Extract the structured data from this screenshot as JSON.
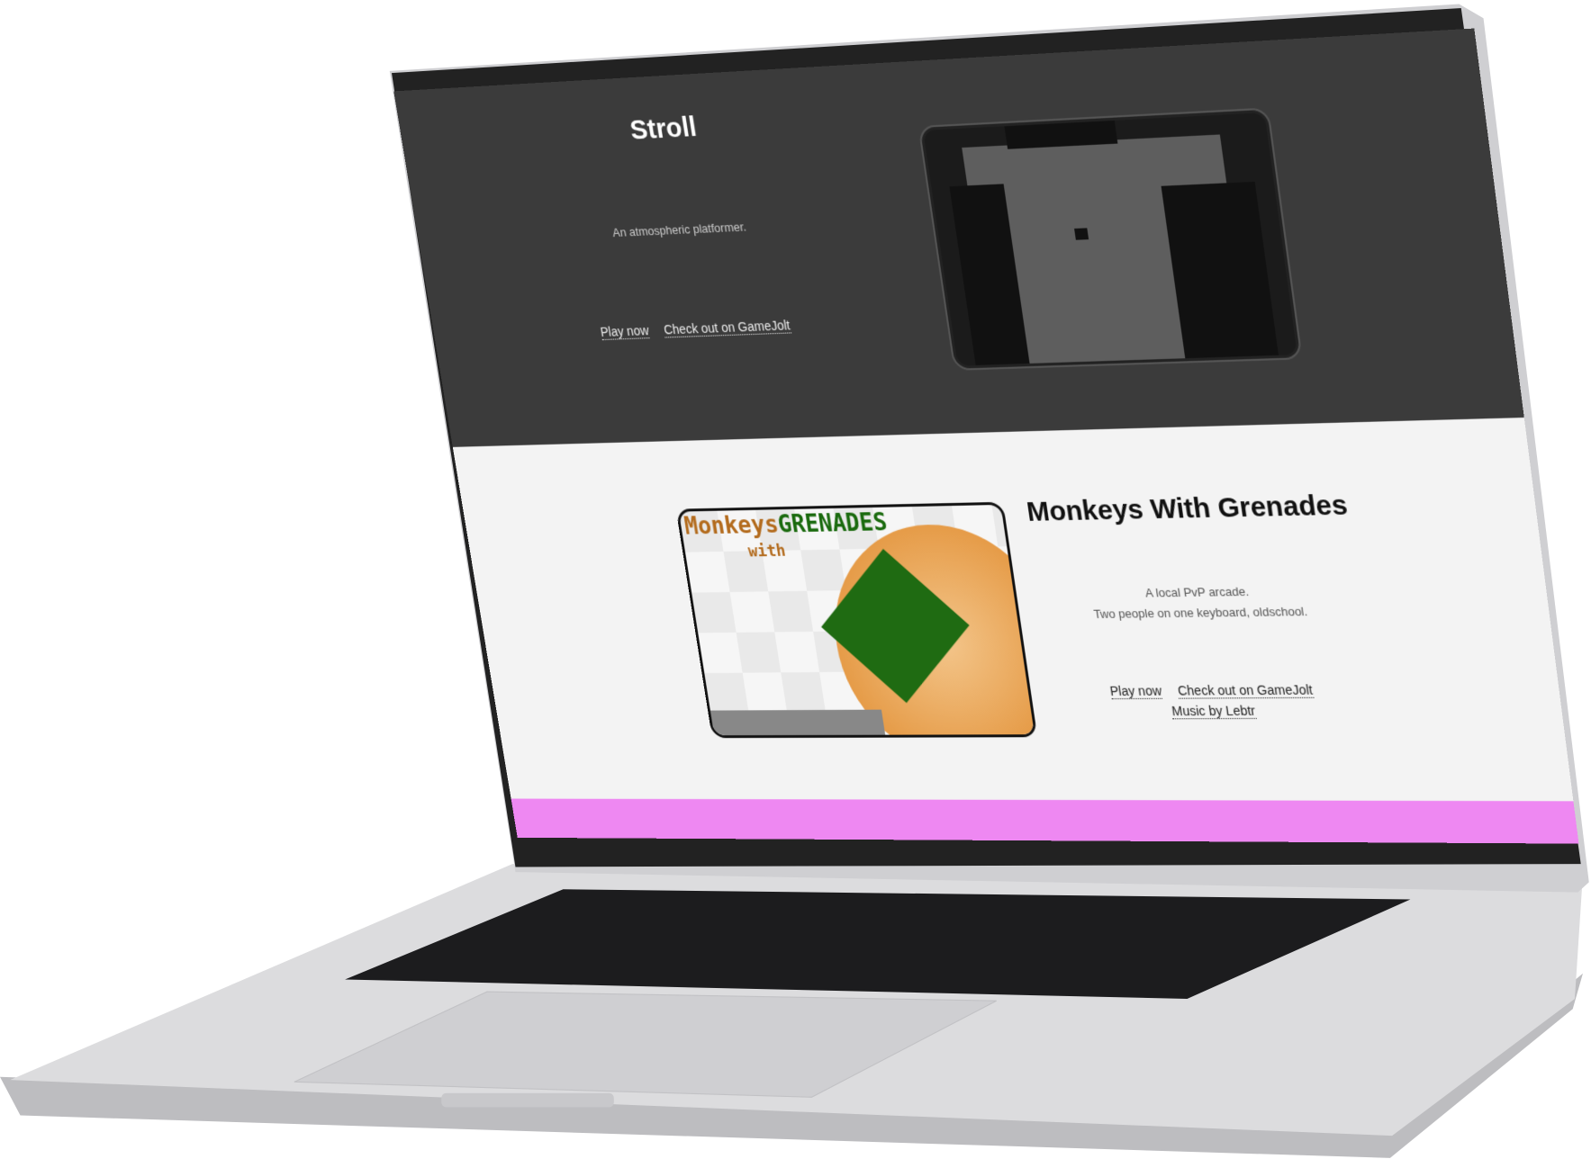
{
  "colors": {
    "dark_section": "#3b3b3b",
    "light_section": "#f3f3f3",
    "accent_band": "#ee88f2",
    "laptop_body": "#d9d9db"
  },
  "stroll": {
    "title": "Stroll",
    "description": "An atmospheric platformer.",
    "links": [
      "Play now",
      "Check out on GameJolt"
    ]
  },
  "monkeys": {
    "title": "Monkeys With Grenades",
    "description_lines": [
      "A local PvP arcade.",
      "Two people on one keyboard, oldschool."
    ],
    "links": [
      "Play now",
      "Check out on GameJolt"
    ],
    "music_link": "Music by Lebtr",
    "logo": {
      "word1": "Monkeys",
      "word2": "with",
      "word3": "GRENADES"
    }
  }
}
